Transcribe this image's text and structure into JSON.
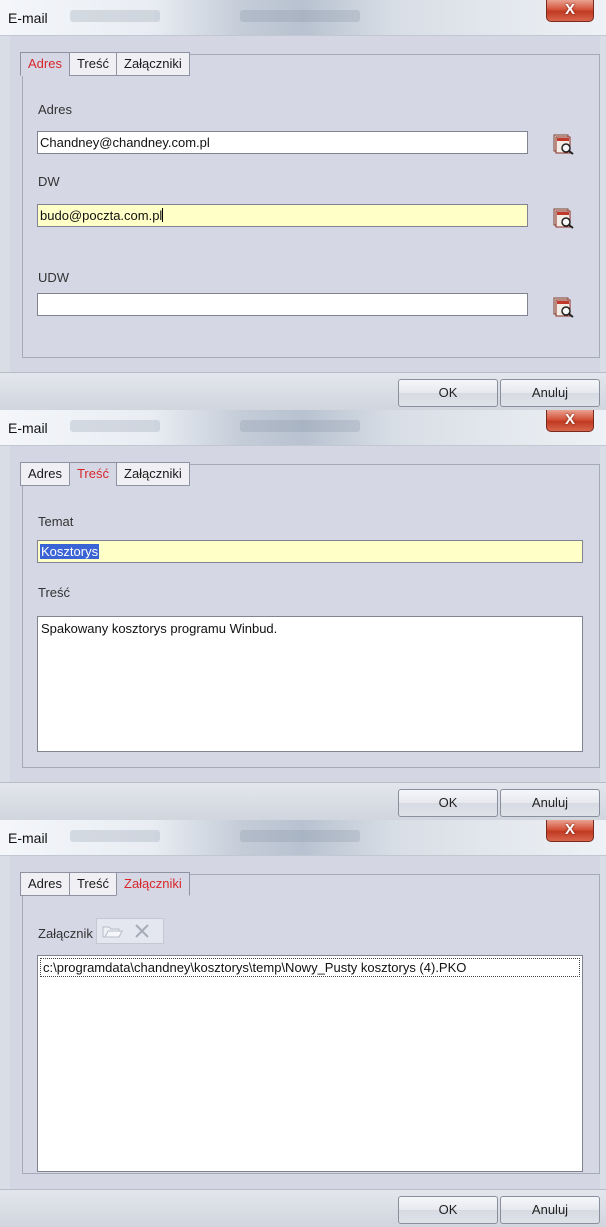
{
  "dialogs": [
    {
      "title": "E-mail",
      "close_label": "X",
      "tabs": [
        {
          "label": "Adres",
          "active": true
        },
        {
          "label": "Treść",
          "active": false
        },
        {
          "label": "Załączniki",
          "active": false
        }
      ],
      "address_label": "Adres",
      "address_value": "Chandney@chandney.com.pl",
      "cc_label": "DW",
      "cc_value": "budo@poczta.com.pl",
      "bcc_label": "UDW",
      "bcc_value": "",
      "ok_label": "OK",
      "cancel_label": "Anuluj"
    },
    {
      "title": "E-mail",
      "close_label": "X",
      "tabs": [
        {
          "label": "Adres",
          "active": false
        },
        {
          "label": "Treść",
          "active": true
        },
        {
          "label": "Załączniki",
          "active": false
        }
      ],
      "subject_label": "Temat",
      "subject_value": "Kosztorys",
      "body_label": "Treść",
      "body_value": "Spakowany kosztorys programu Winbud.",
      "ok_label": "OK",
      "cancel_label": "Anuluj"
    },
    {
      "title": "E-mail",
      "close_label": "X",
      "tabs": [
        {
          "label": "Adres",
          "active": false
        },
        {
          "label": "Treść",
          "active": false
        },
        {
          "label": "Załączniki",
          "active": true
        }
      ],
      "attachments_label": "Załącznik",
      "attachments": [
        "c:\\programdata\\chandney\\kosztorys\\temp\\Nowy_Pusty kosztorys (4).PKO"
      ],
      "ok_label": "OK",
      "cancel_label": "Anuluj"
    }
  ],
  "colors": {
    "active_tab": "#d8262b",
    "panel_bg": "#d6d7e5",
    "highlight_field": "#ffffc8",
    "selection": "#3a64d6"
  },
  "icons": {
    "address_book": "address-book-icon",
    "open_folder": "open-folder-icon",
    "delete": "delete-x-icon",
    "close": "close-icon"
  }
}
